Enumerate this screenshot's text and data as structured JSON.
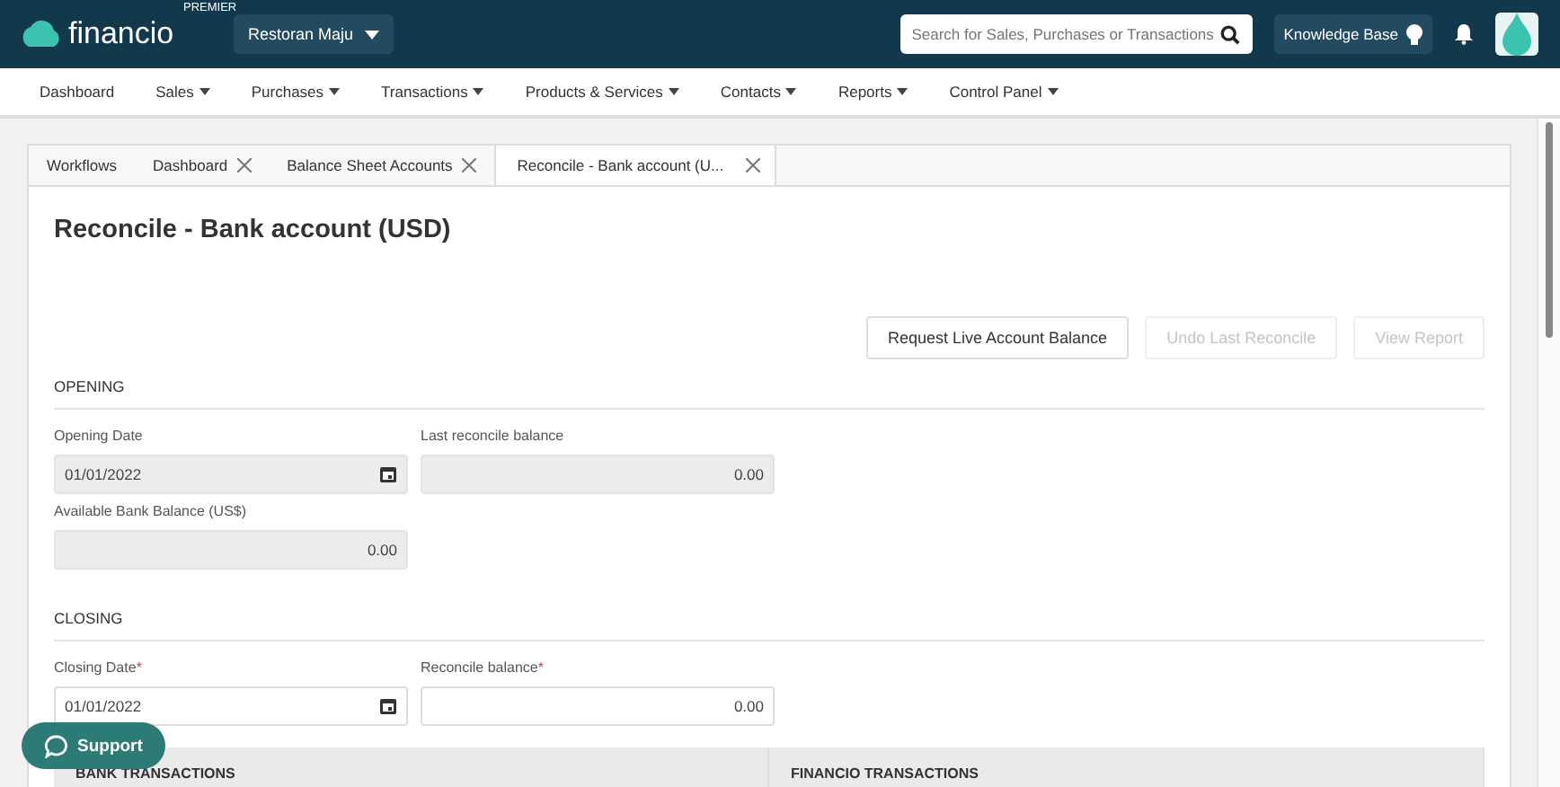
{
  "header": {
    "logo": "financio",
    "plan_badge": "PREMIER",
    "company": "Restoran Maju",
    "search": {
      "placeholder": "Search for Sales, Purchases or Transactions"
    },
    "knowledge_base": "Knowledge Base"
  },
  "nav": [
    {
      "label": "Dashboard",
      "dropdown": false
    },
    {
      "label": "Sales",
      "dropdown": true
    },
    {
      "label": "Purchases",
      "dropdown": true
    },
    {
      "label": "Transactions",
      "dropdown": true
    },
    {
      "label": "Products & Services",
      "dropdown": true
    },
    {
      "label": "Contacts",
      "dropdown": true
    },
    {
      "label": "Reports",
      "dropdown": true
    },
    {
      "label": "Control Panel",
      "dropdown": true
    }
  ],
  "tabs": [
    {
      "label": "Workflows",
      "closable": false,
      "selected": false
    },
    {
      "label": "Dashboard",
      "closable": true,
      "selected": false
    },
    {
      "label": "Balance Sheet Accounts",
      "closable": true,
      "selected": false
    },
    {
      "label": "Reconcile - Bank account (U...",
      "closable": true,
      "selected": true
    }
  ],
  "page": {
    "title": "Reconcile - Bank account (USD)",
    "buttons": [
      {
        "label": "Request Live Account Balance",
        "disabled": false
      },
      {
        "label": "Undo Last Reconcile",
        "disabled": true
      },
      {
        "label": "View Report",
        "disabled": true
      }
    ],
    "sections": [
      {
        "heading": "OPENING",
        "fields": [
          {
            "label": "Opening Date",
            "value": "01/01/2022",
            "kind": "date",
            "disabled": true
          },
          {
            "label": "Last reconcile balance",
            "value": "0.00",
            "kind": "amount",
            "disabled": true
          },
          {
            "label": "Available Bank Balance (US$)",
            "value": "0.00",
            "kind": "amount",
            "disabled": true
          }
        ]
      },
      {
        "heading": "CLOSING",
        "fields": [
          {
            "label": "Closing Date",
            "required_mark": "*",
            "value": "01/01/2022",
            "kind": "date",
            "disabled": false
          },
          {
            "label": "Reconcile balance",
            "required_mark": "*",
            "value": "0.00",
            "kind": "amount",
            "disabled": false
          }
        ]
      }
    ],
    "panels": [
      "BANK TRANSACTIONS",
      "FINANCIO TRANSACTIONS"
    ]
  },
  "support_button": "Support"
}
